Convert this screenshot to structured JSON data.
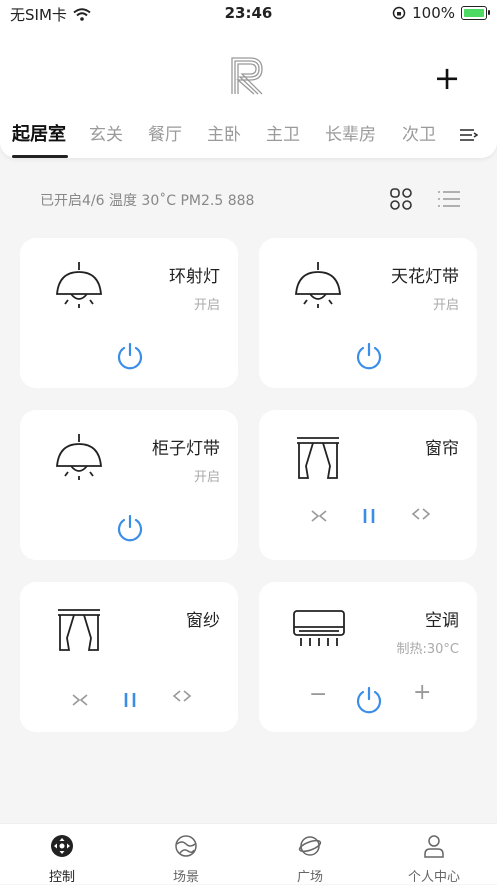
{
  "status_bar": {
    "carrier": "无SIM卡",
    "time": "23:46",
    "battery": "100%"
  },
  "header": {
    "tabs": [
      "起居室",
      "玄关",
      "餐厅",
      "主卧",
      "主卫",
      "长辈房",
      "次卫"
    ],
    "active_tab": 0
  },
  "info": {
    "text": "已开启4/6 温度 30˚C PM2.5 888"
  },
  "devices": [
    {
      "name": "环射灯",
      "status": "开启"
    },
    {
      "name": "天花灯带",
      "status": "开启"
    },
    {
      "name": "柜子灯带",
      "status": "开启"
    },
    {
      "name": "窗帘",
      "status": ""
    },
    {
      "name": "窗纱",
      "status": ""
    },
    {
      "name": "空调",
      "status": "制热:30°C"
    }
  ],
  "ac_controls": {
    "minus": "−",
    "plus": "+"
  },
  "nav": [
    {
      "label": "控制"
    },
    {
      "label": "场景"
    },
    {
      "label": "广场"
    },
    {
      "label": "个人中心"
    }
  ],
  "colors": {
    "accent": "#3b8ee8",
    "inactive": "#999999"
  }
}
